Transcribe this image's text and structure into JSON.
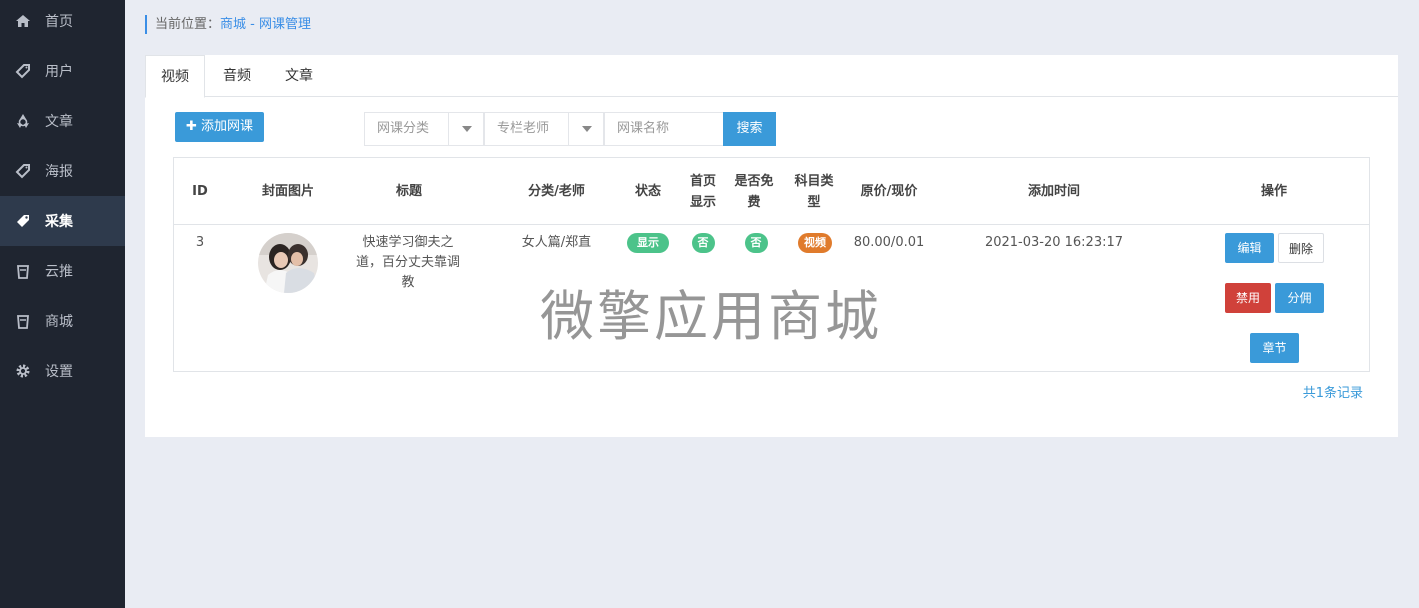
{
  "sidebar": {
    "items": [
      {
        "label": "首页",
        "icon": "home-icon"
      },
      {
        "label": "用户",
        "icon": "tag-icon"
      },
      {
        "label": "文章",
        "icon": "recycle-icon"
      },
      {
        "label": "海报",
        "icon": "tag-icon"
      },
      {
        "label": "采集",
        "icon": "tag-icon",
        "active": true
      },
      {
        "label": "云推",
        "icon": "bucket-icon"
      },
      {
        "label": "商城",
        "icon": "bucket-icon"
      },
      {
        "label": "设置",
        "icon": "gear-icon"
      }
    ]
  },
  "breadcrumb": {
    "prefix": "当前位置：",
    "path": "商城 - 网课管理"
  },
  "tabs": [
    {
      "label": "视频",
      "active": true
    },
    {
      "label": "音频"
    },
    {
      "label": "文章"
    }
  ],
  "toolbar": {
    "add_label": "✚ 添加网课",
    "category_placeholder": "网课分类",
    "teacher_placeholder": "专栏老师",
    "name_placeholder": "网课名称",
    "search_label": "搜索"
  },
  "table": {
    "headers": {
      "id": "ID",
      "cover": "封面图片",
      "title": "标题",
      "category": "分类/老师",
      "status": "状态",
      "home": "首页显示",
      "free": "是否免费",
      "subject": "科目类型",
      "price": "原价/现价",
      "time": "添加时间",
      "ops": "操作"
    },
    "rows": [
      {
        "id": "3",
        "title": "快速学习御夫之道，百分丈夫靠调教",
        "category": "女人篇/郑直",
        "status": "显示",
        "home": "否",
        "free": "否",
        "subject": "视频",
        "price": "80.00/0.01",
        "time": "2021-03-20 16:23:17",
        "actions": {
          "edit": "编辑",
          "delete": "删除",
          "disable": "禁用",
          "commission": "分佣",
          "chapter": "章节"
        }
      }
    ]
  },
  "footer": {
    "total": "共1条记录"
  },
  "watermark": "微擎应用商城",
  "colors": {
    "sidebar_bg": "#1f2530",
    "sidebar_active": "#2e3a4c",
    "primary": "#3a9ad9",
    "success": "#4cc38a",
    "orange": "#e07b2c",
    "danger": "#d0413a"
  }
}
